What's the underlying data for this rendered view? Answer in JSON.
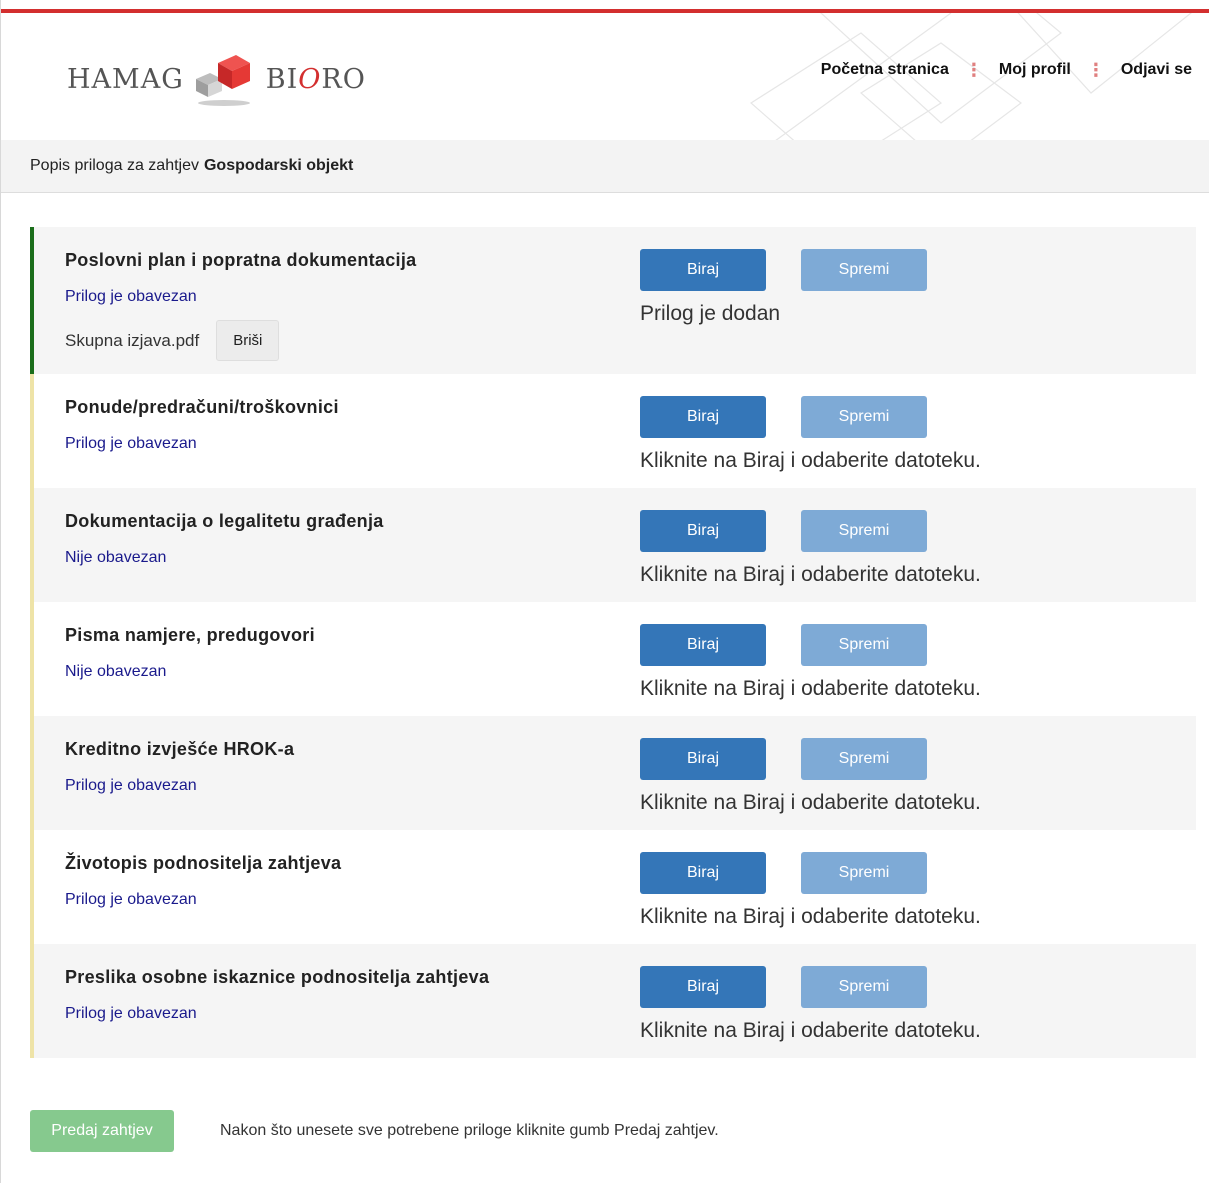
{
  "header": {
    "logo": {
      "left_text": "HAMAG",
      "right_text_start": "BI",
      "right_text_o": "O",
      "right_text_end": "RO"
    },
    "nav": [
      {
        "label": "Početna stranica"
      },
      {
        "label": "Moj profil"
      },
      {
        "label": "Odjavi se"
      }
    ],
    "nav_separator": "⋮"
  },
  "title_bar": {
    "prefix": "Popis priloga za zahtjev",
    "request_name": "Gospodarski objekt"
  },
  "attachments": [
    {
      "title": "Poslovni plan i popratna dokumentacija",
      "status": "Prilog je obavezan",
      "file_name": "Skupna izjava.pdf",
      "delete_label": "Briši",
      "choose_label": "Biraj",
      "save_label": "Spremi",
      "message": "Prilog je dodan"
    },
    {
      "title": "Ponude/predračuni/troškovnici",
      "status": "Prilog je obavezan",
      "choose_label": "Biraj",
      "save_label": "Spremi",
      "message": "Kliknite na Biraj i odaberite datoteku."
    },
    {
      "title": "Dokumentacija o legalitetu građenja",
      "status": "Nije obavezan",
      "choose_label": "Biraj",
      "save_label": "Spremi",
      "message": "Kliknite na Biraj i odaberite datoteku."
    },
    {
      "title": "Pisma namjere, predugovori",
      "status": "Nije obavezan",
      "choose_label": "Biraj",
      "save_label": "Spremi",
      "message": "Kliknite na Biraj i odaberite datoteku."
    },
    {
      "title": "Kreditno izvješće HROK-a",
      "status": "Prilog je obavezan",
      "choose_label": "Biraj",
      "save_label": "Spremi",
      "message": "Kliknite na Biraj i odaberite datoteku."
    },
    {
      "title": "Životopis podnositelja zahtjeva",
      "status": "Prilog je obavezan",
      "choose_label": "Biraj",
      "save_label": "Spremi",
      "message": "Kliknite na Biraj i odaberite datoteku."
    },
    {
      "title": "Preslika osobne iskaznice podnositelja zahtjeva",
      "status": "Prilog je obavezan",
      "choose_label": "Biraj",
      "save_label": "Spremi",
      "message": "Kliknite na Biraj i odaberite datoteku."
    }
  ],
  "footer": {
    "submit_label": "Predaj zahtjev",
    "note": "Nakon što unesete sve potrebene priloge kliknite gumb Predaj zahtjev."
  },
  "colors": {
    "brand_red": "#d32f2f",
    "primary_button": "#3476b8",
    "secondary_button": "#7eaad6",
    "submit_button": "#86c98e",
    "attached_indicator": "#1b6e1b",
    "pending_indicator": "#eee3a7",
    "status_text": "#1a1a8c"
  }
}
